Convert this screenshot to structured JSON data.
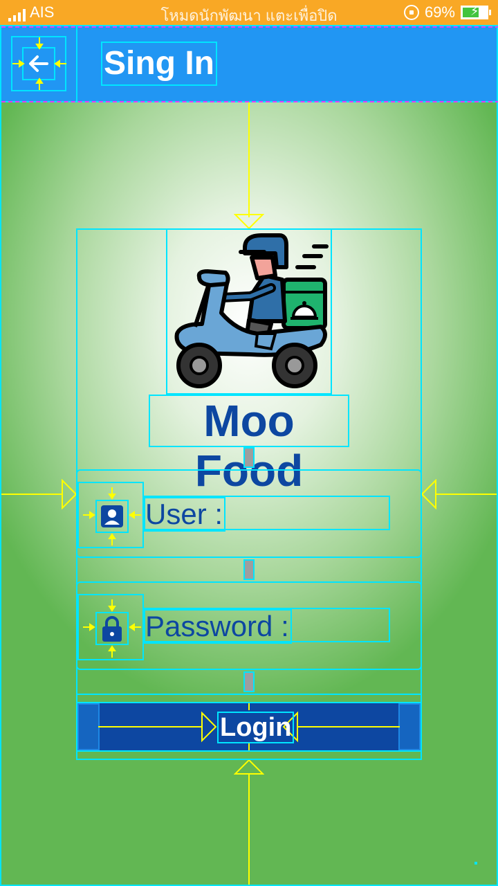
{
  "status_bar": {
    "carrier": "AIS",
    "notice": "โหมดนักพัฒนา แตะเพื่อปิด",
    "battery": "69%",
    "battery_level": 0.69
  },
  "app_bar": {
    "title": "Sing In",
    "back_icon": "arrow-back-icon"
  },
  "brand": {
    "name": "Moo Food",
    "logo": "delivery-scooter-illustration"
  },
  "form": {
    "user_label": "User :",
    "user_icon": "account-box-icon",
    "password_label": "Password :",
    "password_icon": "lock-icon",
    "login_label": "Login"
  },
  "colors": {
    "status_bar": "#f9a825",
    "app_bar": "#2196f3",
    "brand_text": "#0d47a1",
    "login_button": "#0d47a1",
    "background_edge": "#62b753"
  }
}
